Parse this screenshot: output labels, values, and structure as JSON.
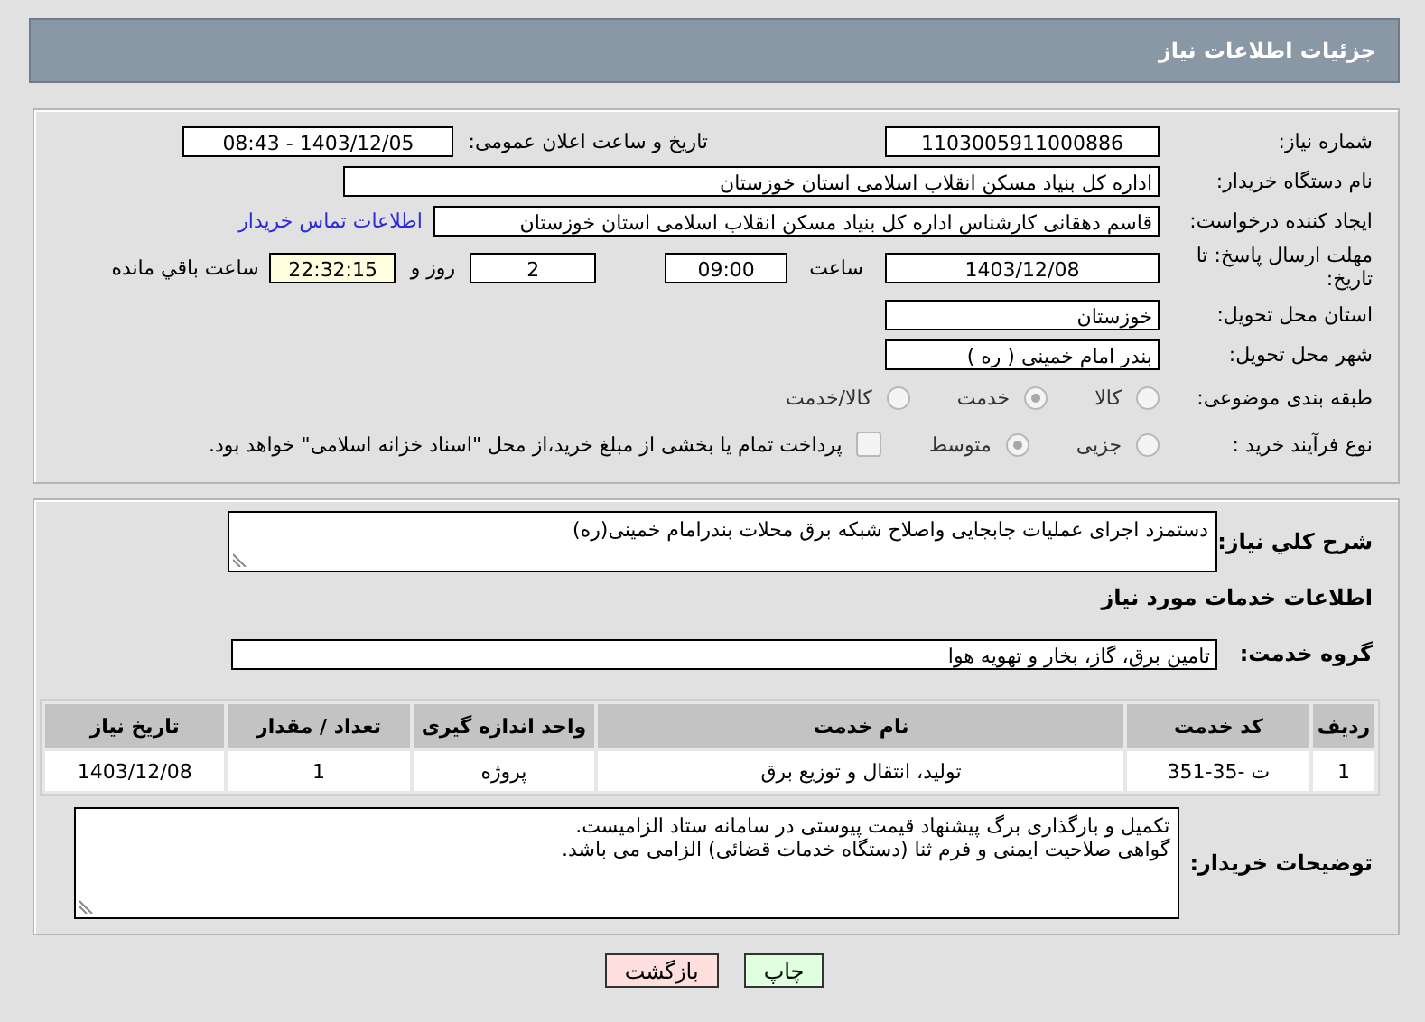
{
  "header": {
    "title": "جزئیات اطلاعات نیاز"
  },
  "details": {
    "need_number": {
      "label": "شماره نیاز:",
      "value": "1103005911000886"
    },
    "announce": {
      "label": "تاریخ و ساعت اعلان عمومی:",
      "value": "1403/12/05 - 08:43"
    },
    "buyer": {
      "label": "نام دستگاه خریدار:",
      "value": "اداره کل بنیاد مسکن انقلاب اسلامی استان خوزستان"
    },
    "creator": {
      "label": "ایجاد کننده درخواست:",
      "value": "قاسم دهقانی کارشناس اداره کل بنیاد مسکن انقلاب اسلامی استان خوزستان",
      "link": "اطلاعات تماس خریدار"
    },
    "deadline": {
      "label": "مهلت ارسال پاسخ: تا تاریخ:",
      "date": "1403/12/08",
      "time_label": "ساعت",
      "time": "09:00",
      "days": "2",
      "days_label": "روز و",
      "remaining": "22:32:15",
      "remaining_label": "ساعت باقي مانده"
    },
    "province": {
      "label": "استان محل تحویل:",
      "value": "خوزستان"
    },
    "city": {
      "label": "شهر محل تحویل:",
      "value": "بندر امام خمینی ( ره )"
    },
    "category": {
      "label": "طبقه بندی موضوعی:",
      "options": [
        {
          "label": "کالا",
          "selected": false,
          "disabled": true
        },
        {
          "label": "خدمت",
          "selected": true,
          "disabled": true
        },
        {
          "label": "کالا/خدمت",
          "selected": false,
          "disabled": true
        }
      ]
    },
    "purchase_type": {
      "label": "نوع فرآیند خرید :",
      "options": [
        {
          "label": "جزیی",
          "selected": false,
          "disabled": true
        },
        {
          "label": "متوسط",
          "selected": true,
          "disabled": true
        }
      ],
      "payment": {
        "label": "پرداخت تمام یا بخشی از مبلغ خرید،از محل \"اسناد خزانه اسلامی\" خواهد بود.",
        "checked": false,
        "disabled": true
      }
    }
  },
  "services": {
    "summary": {
      "label": "شرح کلي نیاز:",
      "value": "دستمزد اجرای عملیات جابجایی واصلاح شبکه برق محلات بندرامام خمینی(ره)"
    },
    "section_title": "اطلاعات خدمات مورد نیاز",
    "group": {
      "label": "گروه خدمت:",
      "value": "تامین برق، گاز، بخار و تهویه هوا"
    },
    "table": {
      "columns": [
        "ردیف",
        "کد خدمت",
        "نام خدمت",
        "واحد اندازه گیری",
        "تعداد / مقدار",
        "تاریخ نیاز"
      ],
      "rows": [
        [
          "1",
          "ت -35-351",
          "تولید، انتقال و توزیع برق",
          "پروژه",
          "1",
          "1403/12/08"
        ]
      ]
    },
    "notes": {
      "label": "توضیحات خریدار:",
      "lines": [
        "تکمیل و بارگذاری برگ پیشنهاد قیمت پیوستی در سامانه ستاد الزامیست.",
        "گواهی صلاحیت ایمنی و فرم ثنا (دستگاه خدمات قضائی) الزامی می باشد."
      ]
    }
  },
  "buttons": [
    {
      "label": "چاپ",
      "kind": "print"
    },
    {
      "label": "بازگشت",
      "kind": "back"
    }
  ]
}
